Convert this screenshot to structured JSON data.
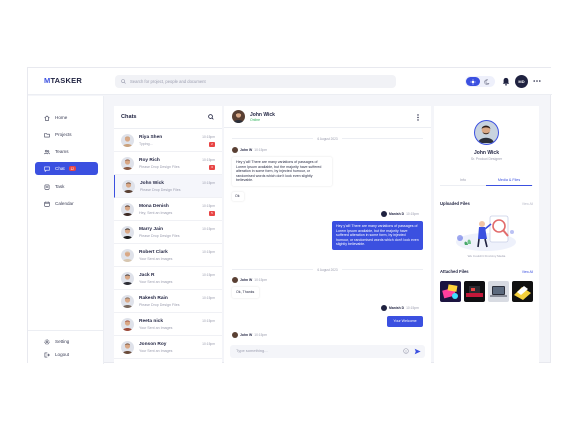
{
  "header": {
    "logo_prefix": "M",
    "logo_rest": "TASKER",
    "search_placeholder": "Search for project, people and document",
    "avatar_initials": "MD"
  },
  "sidebar": {
    "items": [
      {
        "label": "Home",
        "icon": "home-icon"
      },
      {
        "label": "Projects",
        "icon": "folder-icon"
      },
      {
        "label": "Teams",
        "icon": "users-icon"
      },
      {
        "label": "Chat",
        "icon": "chat-icon",
        "badge": "12",
        "active": true
      },
      {
        "label": "Task",
        "icon": "task-icon"
      },
      {
        "label": "Calendar",
        "icon": "calendar-icon"
      }
    ],
    "footer": [
      {
        "label": "Setting",
        "icon": "gear-icon"
      },
      {
        "label": "Logout",
        "icon": "logout-icon"
      }
    ]
  },
  "chats": {
    "title": "Chats",
    "list": [
      {
        "name": "Riya Shen",
        "preview": "Typing...",
        "time": "10:15pm",
        "badge": "2",
        "avatar_color": "#c9a27e"
      },
      {
        "name": "Roy Rich",
        "preview": "Please Drop Design Files",
        "time": "10:15pm",
        "badge": "3",
        "avatar_color": "#8a5a44"
      },
      {
        "name": "John Wick",
        "preview": "Please Drop Design Files",
        "time": "10:15pm",
        "badge": "",
        "avatar_color": "#5a4033",
        "active": true
      },
      {
        "name": "Mona Denish",
        "preview": "Hey, Sent an Images",
        "time": "10:15pm",
        "badge": "5",
        "avatar_color": "#3e2b25"
      },
      {
        "name": "Marry Jain",
        "preview": "Please Drop Design Files",
        "time": "10:15pm",
        "badge": "",
        "avatar_color": "#1c1c1c"
      },
      {
        "name": "Robert Clark",
        "preview": "Your Sent an Images",
        "time": "10:15pm",
        "badge": "",
        "avatar_color": "#d8c7b0"
      },
      {
        "name": "Jack R",
        "preview": "Your Sent an Images",
        "time": "10:15pm",
        "badge": "",
        "avatar_color": "#2d2d35"
      },
      {
        "name": "Rakesh Rain",
        "preview": "Please Drop Design Files",
        "time": "10:15pm",
        "badge": "",
        "avatar_color": "#7a6a5f"
      },
      {
        "name": "Reeta nick",
        "preview": "Your Sent an Images",
        "time": "10:15pm",
        "badge": "",
        "avatar_color": "#9c4a3a"
      },
      {
        "name": "Jonson Roy",
        "preview": "Your Sent an Images",
        "time": "10:15pm",
        "badge": "",
        "avatar_color": "#6b4c3b"
      }
    ]
  },
  "conversation": {
    "name": "John Wick",
    "status": "Online",
    "input_placeholder": "Type something...",
    "date1": "6 August 2023",
    "date2": "6 August 2023",
    "msg1": {
      "author": "John W",
      "time": "10:15pm",
      "text": "Hey y'all! There are many variations of passages of Lorem Ipsum available, but the majority have suffered alteration in some form, by injected humour, or randomised words which don't look even slightly believable."
    },
    "msg2": {
      "text": "Ok"
    },
    "msg3": {
      "author": "Manish D",
      "time": "10:15pm",
      "text": "Hey y'all! There are many variations of passages of Lorem Ipsum available, but the majority have suffered alteration in some form, by injected humour, or randomised words which don't look even slightly believable."
    },
    "msg4": {
      "author": "John W",
      "time": "10:15pm",
      "text": "Ok, Thanks"
    },
    "msg5": {
      "author": "Manish D",
      "time": "10:15pm",
      "text": "Your Welcome"
    },
    "msg6": {
      "author": "John W",
      "time": "10:15pm"
    }
  },
  "profile": {
    "name": "John Wick",
    "role": "Sr. Product Designer",
    "tabs": [
      "Info",
      "Media & Files"
    ],
    "uploaded_title": "Uploaded Files",
    "uploaded_link": "View All",
    "empty_caption": "We Couldn't Find Any Media",
    "attached_title": "Attached Files",
    "attached_link": "View All"
  },
  "colors": {
    "accent": "#3b50e0",
    "badge": "#e84545",
    "online": "#2fb35c"
  }
}
